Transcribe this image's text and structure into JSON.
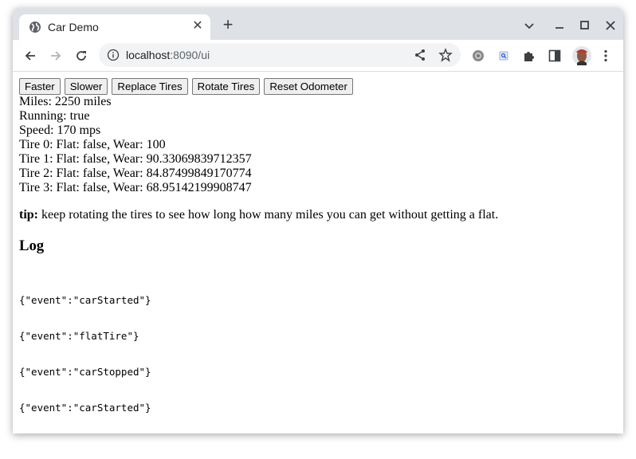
{
  "browser": {
    "tab_title": "Car Demo",
    "url_host": "localhost",
    "url_rest": ":8090/ui",
    "icons": [
      "globe-icon",
      "close-icon",
      "plus-icon",
      "chevron-down-icon",
      "minimize-icon",
      "maximize-icon",
      "window-close-icon",
      "back-icon",
      "forward-icon",
      "reload-icon",
      "info-icon",
      "share-icon",
      "star-icon",
      "settings-extension-icon",
      "search-extension-icon",
      "puzzle-icon",
      "side-panel-icon",
      "avatar",
      "kebab-menu-icon"
    ]
  },
  "controls": {
    "buttons": [
      "Faster",
      "Slower",
      "Replace Tires",
      "Rotate Tires",
      "Reset Odometer"
    ]
  },
  "status": {
    "miles": "Miles: 2250 miles",
    "running": "Running: true",
    "speed": "Speed: 170 mps",
    "tires": [
      "Tire 0: Flat: false, Wear: 100",
      "Tire 1: Flat: false, Wear: 90.33069839712357",
      "Tire 2: Flat: false, Wear: 84.87499849170774",
      "Tire 3: Flat: false, Wear: 68.95142199908747"
    ]
  },
  "tip": {
    "label": "tip:",
    "text": " keep rotating the tires to see how long how many miles you can get without getting a flat."
  },
  "log": {
    "heading": "Log",
    "entries": [
      "{\"event\":\"carStarted\"}",
      "{\"event\":\"flatTire\"}",
      "{\"event\":\"carStopped\"}",
      "{\"event\":\"carStarted\"}"
    ]
  }
}
